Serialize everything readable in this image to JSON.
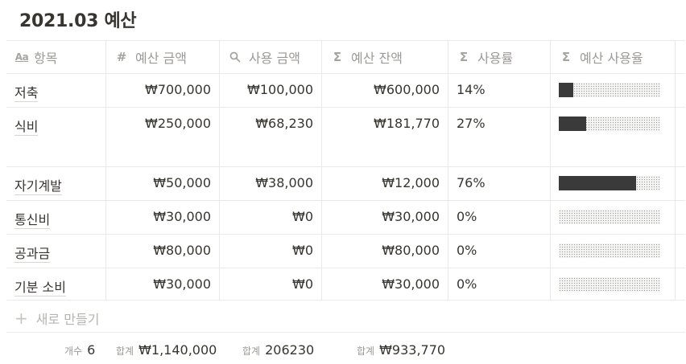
{
  "page_title": "2021.03 예산",
  "columns": [
    {
      "icon": "Aa",
      "label": "항목"
    },
    {
      "icon": "#",
      "label": "예산 금액"
    },
    {
      "icon": "search-icon",
      "label": "사용 금액"
    },
    {
      "icon": "Σ",
      "label": "예산 잔액"
    },
    {
      "icon": "Σ",
      "label": "사용률"
    },
    {
      "icon": "Σ",
      "label": "예산 사용율"
    }
  ],
  "rows": [
    {
      "name": "저축",
      "budget": "₩700,000",
      "spent": "₩100,000",
      "remaining": "₩600,000",
      "rate": "14%",
      "progress": 0.14
    },
    {
      "name": "식비",
      "budget": "₩250,000",
      "spent": "₩68,230",
      "remaining": "₩181,770",
      "rate": "27%",
      "progress": 0.27
    },
    {
      "name": "자기계발",
      "budget": "₩50,000",
      "spent": "₩38,000",
      "remaining": "₩12,000",
      "rate": "76%",
      "progress": 0.76
    },
    {
      "name": "통신비",
      "budget": "₩30,000",
      "spent": "₩0",
      "remaining": "₩30,000",
      "rate": "0%",
      "progress": 0
    },
    {
      "name": "공과금",
      "budget": "₩80,000",
      "spent": "₩0",
      "remaining": "₩80,000",
      "rate": "0%",
      "progress": 0
    },
    {
      "name": "기분 소비",
      "budget": "₩30,000",
      "spent": "₩0",
      "remaining": "₩30,000",
      "rate": "0%",
      "progress": 0
    }
  ],
  "new_row_label": "새로 만들기",
  "footer": {
    "count_label": "개수",
    "count_value": "6",
    "budget_sum_label": "합계",
    "budget_sum_value": "₩1,140,000",
    "spent_sum_label": "합계",
    "spent_sum_value": "206230",
    "remaining_sum_label": "합계",
    "remaining_sum_value": "₩933,770"
  }
}
